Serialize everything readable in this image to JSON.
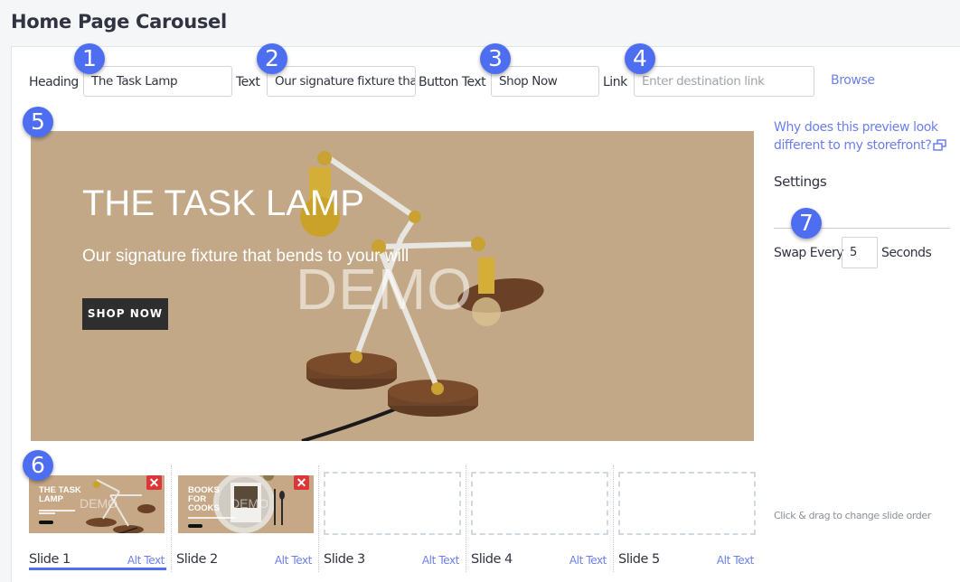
{
  "page": {
    "title": "Home Page Carousel"
  },
  "form": {
    "heading_label": "Heading",
    "heading_value": "The Task Lamp",
    "text_label": "Text",
    "text_value": "Our signature fixture tha",
    "button_text_label": "Button Text",
    "button_text_value": "Shop Now",
    "link_label": "Link",
    "link_placeholder": "Enter destination link",
    "browse_label": "Browse"
  },
  "badges": [
    "1",
    "2",
    "3",
    "4",
    "5",
    "6",
    "7"
  ],
  "preview": {
    "heading": "THE TASK LAMP",
    "subheading": "Our signature fixture that bends to your will",
    "button": "SHOP NOW",
    "watermark": "DEMO",
    "background_color": "#c3a888"
  },
  "sidebar": {
    "preview_help_link": "Why does this preview look different to my storefront?",
    "external_link_icon": "external-link-icon",
    "settings_title": "Settings",
    "swap_label": "Swap Every",
    "swap_value": "5",
    "seconds_label": "Seconds",
    "drag_hint": "Click & drag to change slide order"
  },
  "slides": [
    {
      "name": "Slide 1",
      "alt_text": "Alt Text",
      "thumb_title": "THE TASK LAMP",
      "has_image": true,
      "active": true,
      "delete_icon": "close-icon"
    },
    {
      "name": "Slide 2",
      "alt_text": "Alt Text",
      "thumb_title": "BOOKS FOR COOKS",
      "has_image": true,
      "active": false,
      "delete_icon": "close-icon"
    },
    {
      "name": "Slide 3",
      "alt_text": "Alt Text",
      "has_image": false,
      "active": false
    },
    {
      "name": "Slide 4",
      "alt_text": "Alt Text",
      "has_image": false,
      "active": false
    },
    {
      "name": "Slide 5",
      "alt_text": "Alt Text",
      "has_image": false,
      "active": false
    }
  ],
  "colors": {
    "accent": "#4e6ef2",
    "link": "#6b7ff0",
    "delete": "#dc3636"
  }
}
